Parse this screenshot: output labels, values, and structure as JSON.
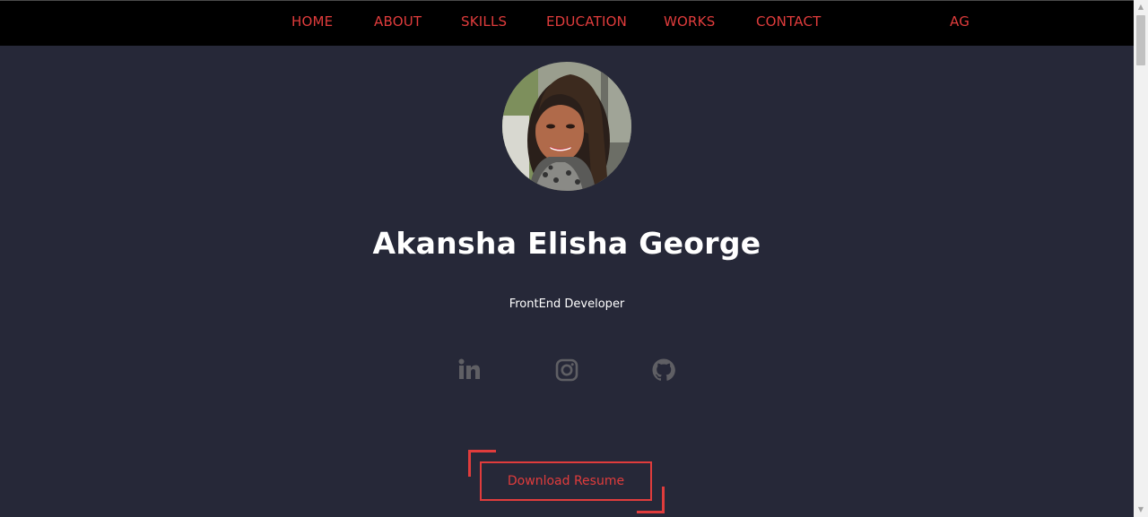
{
  "nav": {
    "items": [
      {
        "label": "HOME"
      },
      {
        "label": "ABOUT"
      },
      {
        "label": "SKILLS"
      },
      {
        "label": "EDUCATION"
      },
      {
        "label": "WORKS"
      },
      {
        "label": "CONTACT"
      }
    ],
    "logo": "AG"
  },
  "hero": {
    "name": "Akansha Elisha George",
    "role": "FrontEnd Developer",
    "socials": [
      {
        "icon": "linkedin-icon"
      },
      {
        "icon": "instagram-icon"
      },
      {
        "icon": "github-icon"
      }
    ],
    "resume_label": "Download Resume"
  },
  "colors": {
    "background": "#262838",
    "navbar": "#000000",
    "accent": "#e03c3c",
    "icon": "#5f5f64",
    "text": "#ffffff"
  }
}
